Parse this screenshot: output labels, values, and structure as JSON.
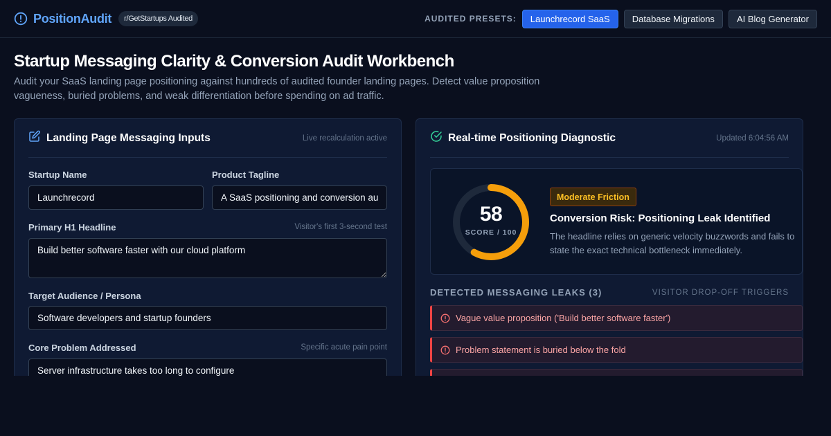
{
  "header": {
    "brand_name": "PositionAudit",
    "badge": "r/GetStartups Audited",
    "presets_label": "AUDITED PRESETS:",
    "presets": [
      {
        "label": "Launchrecord SaaS",
        "active": true
      },
      {
        "label": "Database Migrations",
        "active": false
      },
      {
        "label": "AI Blog Generator",
        "active": false
      }
    ]
  },
  "page": {
    "title": "Startup Messaging Clarity & Conversion Audit Workbench",
    "subtitle": "Audit your SaaS landing page positioning against hundreds of audited founder landing pages. Detect value proposition vagueness, buried problems, and weak differentiation before spending on ad traffic."
  },
  "inputs_panel": {
    "title": "Landing Page Messaging Inputs",
    "meta": "Live recalculation active",
    "fields": {
      "startup_name": {
        "label": "Startup Name",
        "value": "Launchrecord"
      },
      "tagline": {
        "label": "Product Tagline",
        "value": "A SaaS positioning and conversion audit tool"
      },
      "headline": {
        "label": "Primary H1 Headline",
        "hint": "Visitor's first 3-second test",
        "value": "Build better software faster with our cloud platform"
      },
      "audience": {
        "label": "Target Audience / Persona",
        "value": "Software developers and startup founders"
      },
      "problem": {
        "label": "Core Problem Addressed",
        "hint": "Specific acute pain point",
        "value": "Server infrastructure takes too long to configure"
      }
    }
  },
  "diagnostic_panel": {
    "title": "Real-time Positioning Diagnostic",
    "meta": "Updated 6:04:56 AM",
    "score": {
      "value": 58,
      "max": 100,
      "caption": "SCORE / 100",
      "color": "#f59e0b"
    },
    "risk_badge": "Moderate Friction",
    "risk_title": "Conversion Risk: Positioning Leak Identified",
    "risk_desc": "The headline relies on generic velocity buzzwords and fails to state the exact technical bottleneck immediately.",
    "leaks_title": "DETECTED MESSAGING LEAKS (3)",
    "leaks_meta": "VISITOR DROP-OFF TRIGGERS",
    "leaks": [
      "Vague value proposition ('Build better software faster')",
      "Problem statement is buried below the fold",
      ""
    ]
  },
  "colors": {
    "accent": "#2563eb",
    "brand": "#60a5fa",
    "warning": "#f59e0b",
    "danger": "#ef4444",
    "success": "#34d399"
  }
}
